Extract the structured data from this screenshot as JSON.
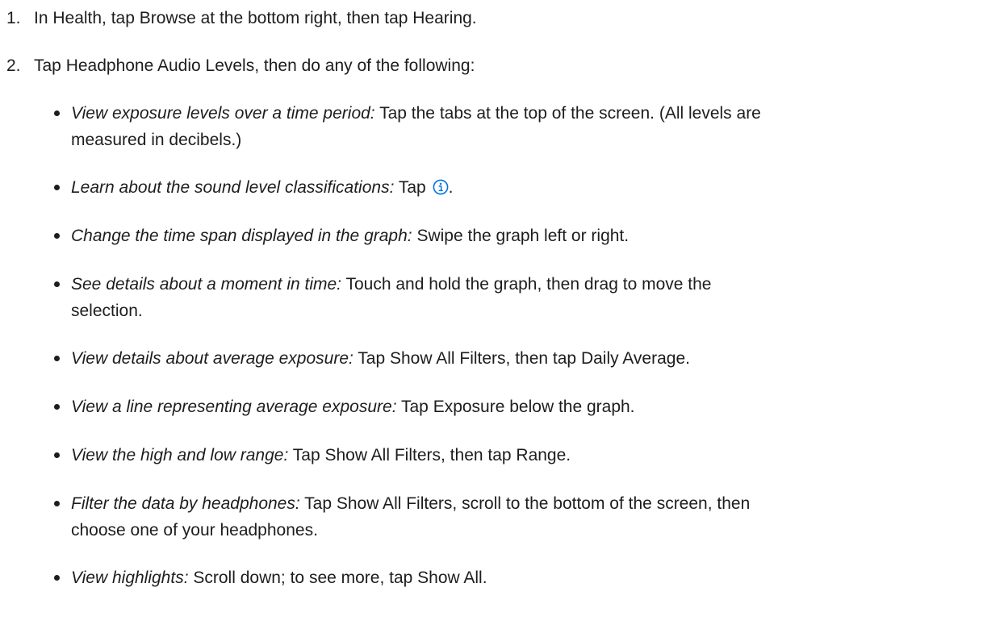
{
  "steps": [
    {
      "number": "1.",
      "text": "In Health, tap Browse at the bottom right, then tap Hearing."
    },
    {
      "number": "2.",
      "text": "Tap Headphone Audio Levels, then do any of the following:"
    }
  ],
  "bullets": [
    {
      "label": "View exposure levels over a time period:",
      "line1": " Tap the tabs at the top of the screen. (All levels are",
      "line2": "measured in decibels.)"
    },
    {
      "label": "Learn about the sound level classifications:",
      "text_before": " Tap ",
      "icon": "info-circle-icon",
      "text_after": "."
    },
    {
      "label": "Change the time span displayed in the graph:",
      "text": " Swipe the graph left or right."
    },
    {
      "label": "See details about a moment in time:",
      "line1": " Touch and hold the graph, then drag to move the",
      "line2": "selection."
    },
    {
      "label": "View details about average exposure:",
      "text": " Tap Show All Filters, then tap Daily Average."
    },
    {
      "label": "View a line representing average exposure:",
      "text": " Tap Exposure below the graph."
    },
    {
      "label": "View the high and low range:",
      "text": " Tap Show All Filters, then tap Range."
    },
    {
      "label": "Filter the data by headphones:",
      "line1": " Tap Show All Filters, scroll to the bottom of the screen, then",
      "line2": "choose one of your headphones."
    },
    {
      "label": "View highlights:",
      "text": " Scroll down; to see more, tap Show All."
    }
  ],
  "colors": {
    "text": "#1d1d1f",
    "info_icon": "#0071e3"
  }
}
